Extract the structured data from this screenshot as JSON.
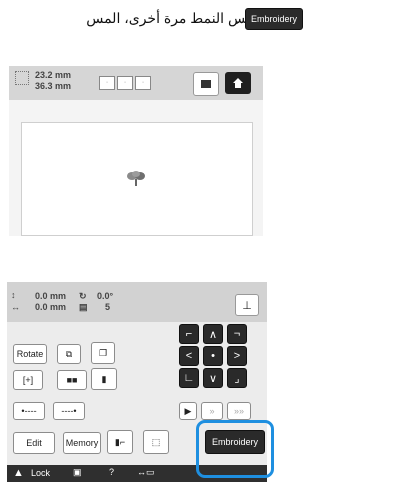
{
  "instruction": {
    "text": "لتطريز نفس النمط مرة أخرى، المس",
    "button_label": "Embroidery",
    "period": "."
  },
  "screen1": {
    "size_width": "23.2 mm",
    "size_height": "36.3 mm",
    "layout_labels": [
      "·",
      "·",
      "·"
    ]
  },
  "screen2": {
    "pos_x": "0.0 mm",
    "pos_y": "0.0 mm",
    "angle": "0.0°",
    "count": "5",
    "rotate_label": "Rotate",
    "edit_label": "Edit",
    "memory_label": "Memory",
    "embroidery_label": "Embroidery",
    "lock_label": "Lock"
  },
  "colors": {
    "dark_button": "#2a2a2a",
    "highlight": "#1e8fe0",
    "header": "#d2d2d2"
  }
}
